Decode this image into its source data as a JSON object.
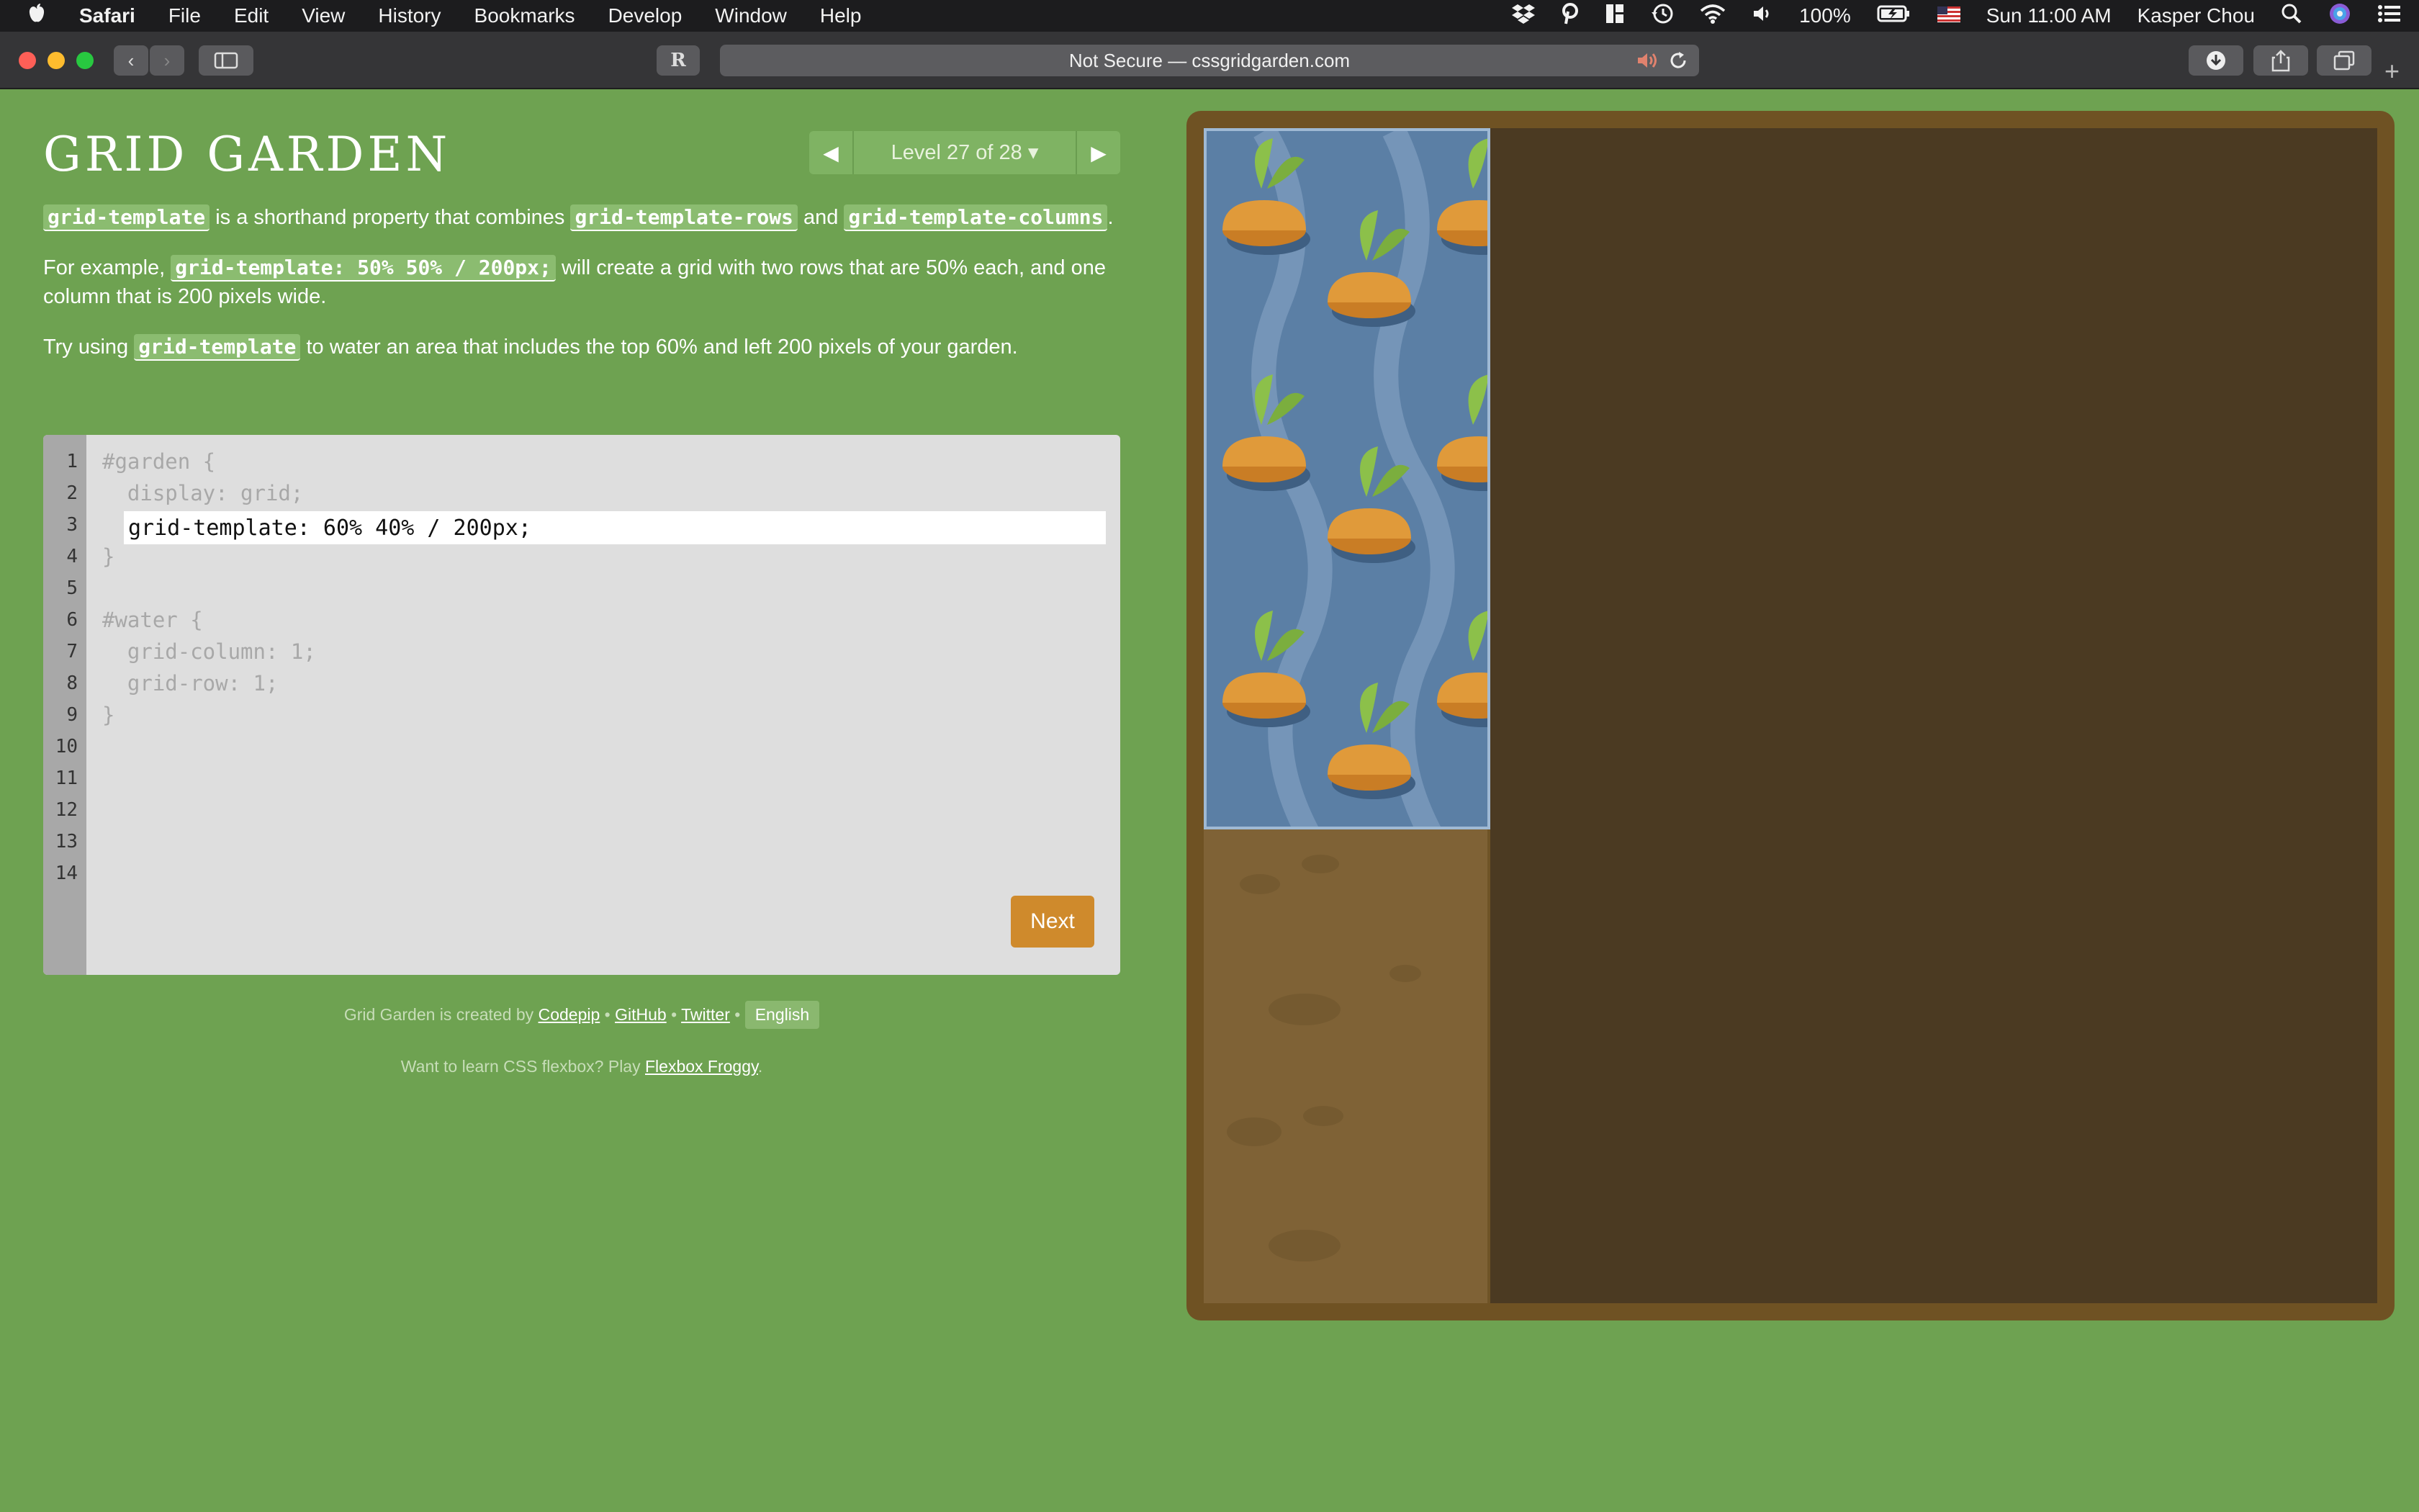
{
  "menubar": {
    "app": "Safari",
    "menus": [
      "File",
      "Edit",
      "View",
      "History",
      "Bookmarks",
      "Develop",
      "Window",
      "Help"
    ],
    "battery": "100%",
    "clock": "Sun 11:00 AM",
    "user": "Kasper Chou"
  },
  "browser": {
    "url_label": "Not Secure — cssgridgarden.com",
    "reader_label": "R"
  },
  "page": {
    "title": "GRID GARDEN",
    "level_label": "Level 27 of 28 ▾",
    "desc": {
      "p1_code1": "grid-template",
      "p1_t1": " is a shorthand property that combines ",
      "p1_code2": "grid-template-rows",
      "p1_t2": " and ",
      "p1_code3": "grid-template-columns",
      "p1_t3": ".",
      "p2_t1": "For example, ",
      "p2_code": "grid-template: 50% 50% / 200px;",
      "p2_t2": " will create a grid with two rows that are 50% each, and one column that is 200 pixels wide.",
      "p3_t1": "Try using ",
      "p3_code": "grid-template",
      "p3_t2": " to water an area that includes the top 60% and left 200 pixels of your garden."
    },
    "editor": {
      "line_numbers": [
        "1",
        "2",
        "3",
        "4",
        "5",
        "6",
        "7",
        "8",
        "9",
        "10",
        "11",
        "12",
        "13",
        "14"
      ],
      "line1": "#garden {",
      "line2": "  display: grid;",
      "input_value": "grid-template: 60% 40% / 200px;",
      "line4": "}",
      "line6": "#water {",
      "line7": "  grid-column: 1;",
      "line8": "  grid-row: 1;",
      "line9": "}",
      "next_label": "Next"
    },
    "footer": {
      "created_by": "Grid Garden is created by ",
      "codepip": "Codepip",
      "sep": " • ",
      "github": "GitHub",
      "twitter": "Twitter",
      "language": "English",
      "flexbox_prefix": "Want to learn CSS flexbox? Play ",
      "flexbox_link": "Flexbox Froggy",
      "flexbox_suffix": "."
    }
  },
  "colors": {
    "page_bg": "#6ea251",
    "water": "#5b7fa5",
    "soil": "#4b3a22",
    "carrot": "#e09a3a",
    "leaf": "#8cc04a",
    "next_button": "#cf8a2c"
  }
}
